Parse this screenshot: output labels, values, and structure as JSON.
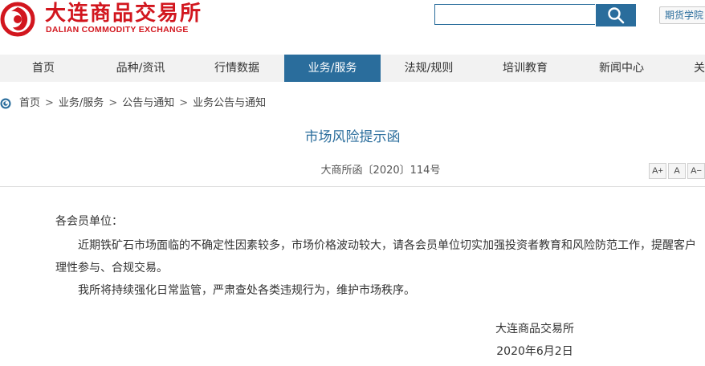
{
  "header": {
    "logo_cn": "大连商品交易所",
    "logo_en": "DALIAN COMMODITY EXCHANGE",
    "search": {
      "placeholder": "",
      "value": ""
    },
    "academy_link": "期货学院",
    "brand_color": "#d2161e",
    "accent_color": "#2a6d9c"
  },
  "nav": {
    "items": [
      {
        "label": "首页",
        "active": false
      },
      {
        "label": "品种/资讯",
        "active": false
      },
      {
        "label": "行情数据",
        "active": false
      },
      {
        "label": "业务/服务",
        "active": true
      },
      {
        "label": "法规/规则",
        "active": false
      },
      {
        "label": "培训教育",
        "active": false
      },
      {
        "label": "新闻中心",
        "active": false
      },
      {
        "label": "关",
        "active": false
      }
    ]
  },
  "breadcrumb": {
    "icon": "home-circle-icon",
    "items": [
      "首页",
      "业务/服务",
      "公告与通知",
      "业务公告与通知"
    ],
    "separator": ">"
  },
  "article": {
    "title": "市场风险提示函",
    "doc_number": "大商所函〔2020〕114号",
    "font_controls": [
      "A+",
      "A",
      "A−"
    ],
    "salutation": "各会员单位：",
    "paragraph1_line1": "近期铁矿石市场面临的不确定性因素较多，市场价格波动较大，请各会员单位切实加强投资者教育和风险防范工作，提醒客户",
    "paragraph1_line2": "理性参与、合规交易。",
    "paragraph2": "我所将持续强化日常监管，严肃查处各类违规行为，维护市场秩序。",
    "signature_org": "大连商品交易所",
    "signature_date": "2020年6月2日"
  }
}
